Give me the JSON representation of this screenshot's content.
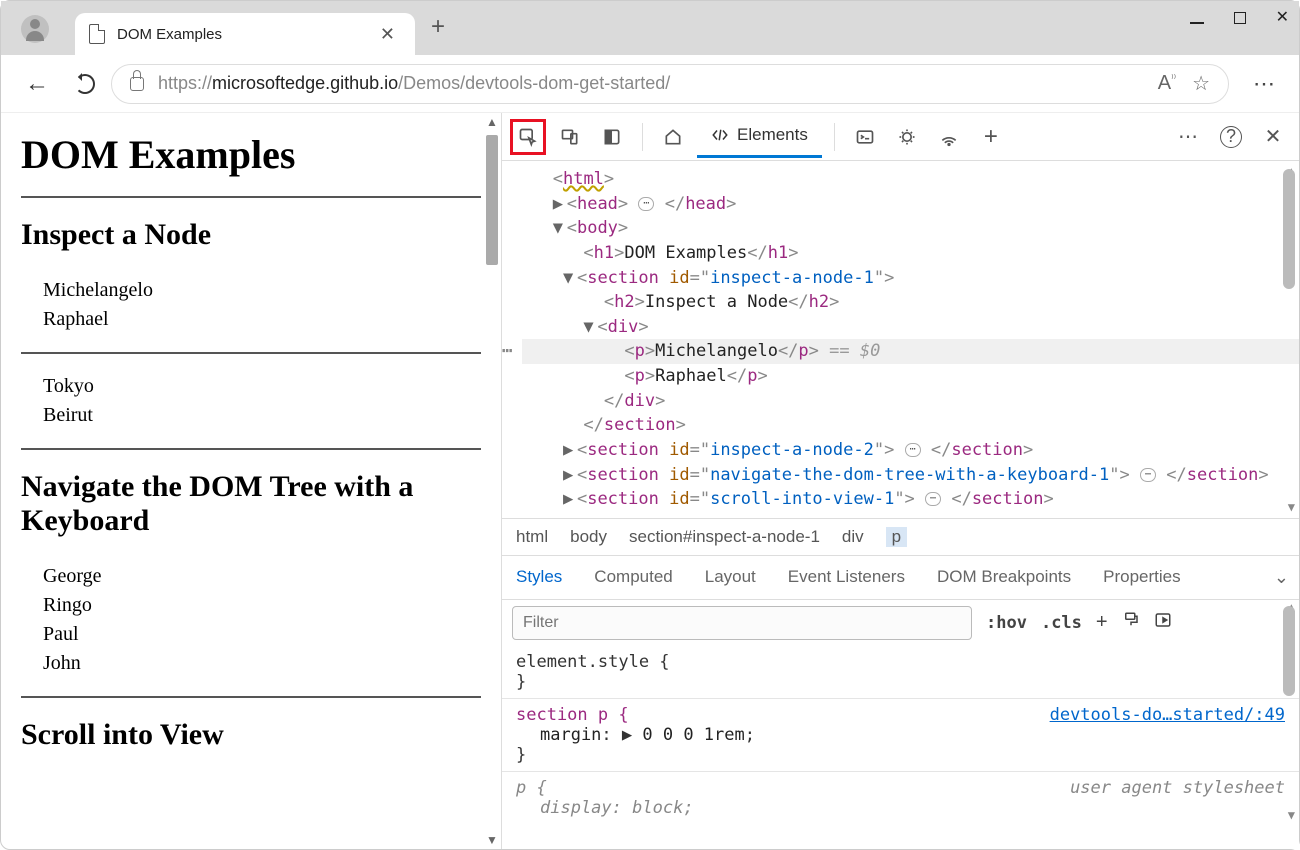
{
  "window": {
    "tab_title": "DOM Examples",
    "url_prefix": "https://",
    "url_host": "microsoftedge.github.io",
    "url_path": "/Demos/devtools-dom-get-started/"
  },
  "page": {
    "h1": "DOM Examples",
    "sections": [
      {
        "h2": "Inspect a Node",
        "groups": [
          [
            "Michelangelo",
            "Raphael"
          ],
          [
            "Tokyo",
            "Beirut"
          ]
        ]
      },
      {
        "h2": "Navigate the DOM Tree with a Keyboard",
        "groups": [
          [
            "George",
            "Ringo",
            "Paul",
            "John"
          ]
        ]
      },
      {
        "h2": "Scroll into View",
        "groups": []
      }
    ]
  },
  "devtools": {
    "tabs": {
      "elements": "Elements"
    },
    "dom": {
      "html": "html",
      "head": "head",
      "body": "body",
      "h1_txt": "DOM Examples",
      "sec1_id": "inspect-a-node-1",
      "h2_txt": "Inspect a Node",
      "p1": "Michelangelo",
      "p2": "Raphael",
      "sel_var": " == $0",
      "sec2_id": "inspect-a-node-2",
      "sec3_id": "navigate-the-dom-tree-with-a-keyboard-1",
      "sec4_id": "scroll-into-view-1"
    },
    "breadcrumb": [
      "html",
      "body",
      "section#inspect-a-node-1",
      "div",
      "p"
    ],
    "styles_tabs": [
      "Styles",
      "Computed",
      "Layout",
      "Event Listeners",
      "DOM Breakpoints",
      "Properties"
    ],
    "filter_placeholder": "Filter",
    "hov": ":hov",
    "cls": ".cls",
    "styles": {
      "element_style": "element.style {",
      "rule1_sel": "section p {",
      "rule1_prop": "margin",
      "rule1_val": "0 0 0 1rem",
      "rule1_link": "devtools-do…started/:49",
      "rule2_sel": "p {",
      "rule2_prop": "display",
      "rule2_val": "block",
      "uas": "user agent stylesheet"
    }
  }
}
